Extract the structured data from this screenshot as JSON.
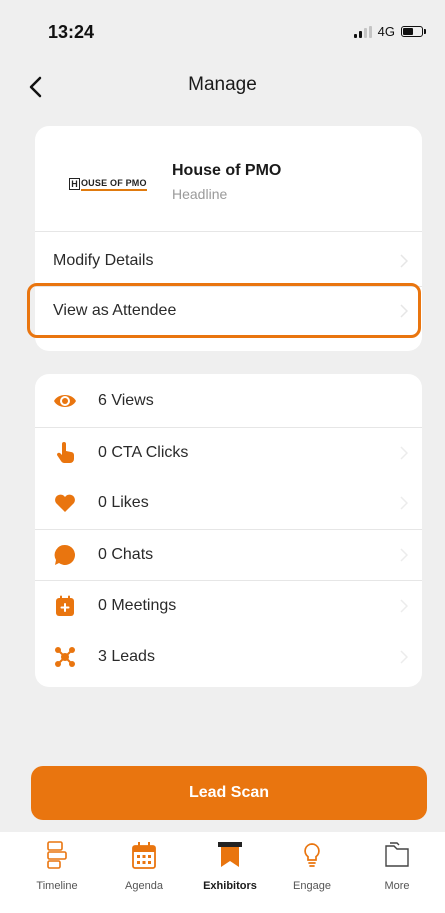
{
  "status_bar": {
    "time": "13:24",
    "network": "4G"
  },
  "nav": {
    "title": "Manage"
  },
  "exhibitor": {
    "logo_text_1": "H",
    "logo_text_2": "OUSE OF PMO",
    "name": "House of PMO",
    "headline": "Headline"
  },
  "menu": [
    {
      "label": "Modify Details"
    },
    {
      "label": "View as Attendee"
    }
  ],
  "stats": [
    {
      "label": "6 Views",
      "icon": "eye-icon"
    },
    {
      "label": "0 CTA Clicks",
      "icon": "pointer-hand-icon"
    },
    {
      "label": "0 Likes",
      "icon": "heart-icon"
    },
    {
      "label": "0 Chats",
      "icon": "chat-bubble-icon"
    },
    {
      "label": "0 Meetings",
      "icon": "calendar-add-icon"
    },
    {
      "label": "3 Leads",
      "icon": "network-icon"
    }
  ],
  "lead_scan": {
    "label": "Lead Scan"
  },
  "tabs": [
    {
      "label": "Timeline",
      "icon": "timeline-icon"
    },
    {
      "label": "Agenda",
      "icon": "calendar-icon"
    },
    {
      "label": "Exhibitors",
      "icon": "banner-icon",
      "active": true
    },
    {
      "label": "Engage",
      "icon": "lightbulb-icon"
    },
    {
      "label": "More",
      "icon": "folder-icon"
    }
  ],
  "colors": {
    "accent": "#e9750f",
    "background": "#efefef"
  }
}
